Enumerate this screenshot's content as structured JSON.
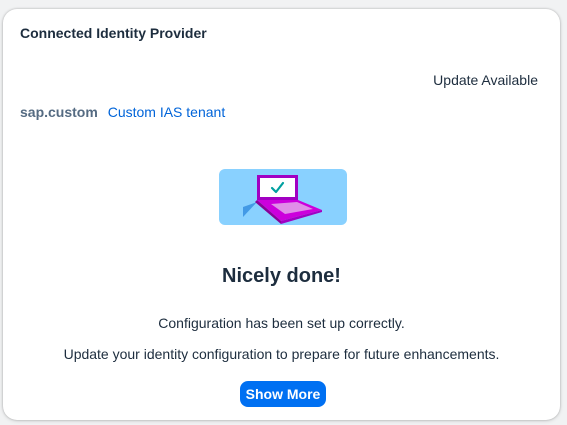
{
  "card": {
    "title": "Connected Identity Provider",
    "status": "Update Available",
    "provider": {
      "key": "sap.custom",
      "name": "Custom IAS tenant"
    }
  },
  "illustration": {
    "icon": "laptop-checkmark-illustration"
  },
  "message": {
    "headline": "Nicely done!",
    "line1": "Configuration has been set up correctly.",
    "line2": "Update your identity configuration to prepare for future enhancements."
  },
  "actions": {
    "show_more_label": "Show More"
  },
  "colors": {
    "link": "#0064d9",
    "button": "#0070f2",
    "illustration_bg": "#89d1ff",
    "laptop": "#cc00dc",
    "check": "#00a0a0"
  }
}
